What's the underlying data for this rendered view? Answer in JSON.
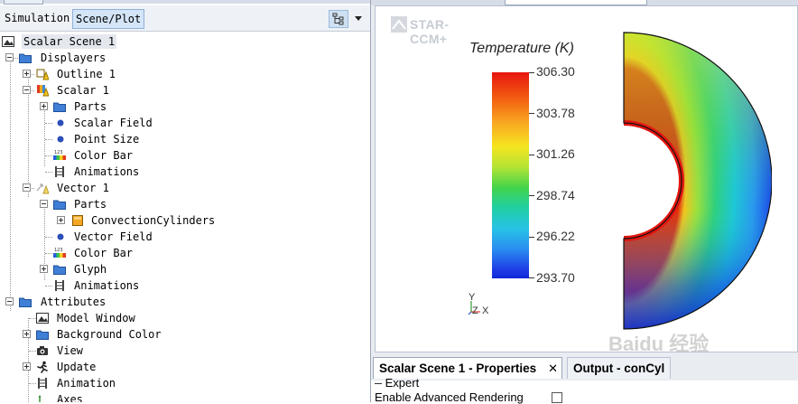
{
  "tabs": {
    "simulation": "Simulation",
    "scene_plot": "Scene/Plot"
  },
  "tree": [
    {
      "label": "Scalar Scene 1",
      "icon": "scene-icon",
      "selected": true
    },
    {
      "label": "Displayers",
      "icon": "folder-icon"
    },
    {
      "label": "Outline 1",
      "icon": "outline-displayer-icon"
    },
    {
      "label": "Scalar 1",
      "icon": "scalar-displayer-icon"
    },
    {
      "label": "Parts",
      "icon": "folder-icon"
    },
    {
      "label": "Scalar Field",
      "icon": "bullet-icon"
    },
    {
      "label": "Point Size",
      "icon": "bullet-icon"
    },
    {
      "label": "Color Bar",
      "icon": "color-bar-icon"
    },
    {
      "label": "Animations",
      "icon": "animations-icon"
    },
    {
      "label": "Vector 1",
      "icon": "vector-displayer-icon"
    },
    {
      "label": "Parts",
      "icon": "folder-icon"
    },
    {
      "label": "ConvectionCylinders",
      "icon": "region-icon"
    },
    {
      "label": "Vector Field",
      "icon": "bullet-icon"
    },
    {
      "label": "Color Bar",
      "icon": "color-bar-icon"
    },
    {
      "label": "Glyph",
      "icon": "folder-icon"
    },
    {
      "label": "Animations",
      "icon": "animations-icon"
    },
    {
      "label": "Attributes",
      "icon": "folder-icon"
    },
    {
      "label": "Model Window",
      "icon": "window-icon"
    },
    {
      "label": "Background Color",
      "icon": "folder-icon"
    },
    {
      "label": "View",
      "icon": "camera-icon"
    },
    {
      "label": "Update",
      "icon": "update-icon"
    },
    {
      "label": "Animation",
      "icon": "animations-icon"
    },
    {
      "label": "Axes",
      "icon": "axes-icon"
    }
  ],
  "viewport": {
    "logo": "STAR-CCM+",
    "triad": {
      "y": "Y",
      "z": "Z",
      "x": "X"
    },
    "watermark": "Baidu 经验"
  },
  "colorbar": {
    "title": "Temperature (K)",
    "labels": [
      "306.30",
      "303.78",
      "301.26",
      "298.74",
      "296.22",
      "293.70"
    ],
    "min": 293.7,
    "max": 306.3,
    "colors": [
      "#e6150f",
      "#f25a10",
      "#f9a521",
      "#f5e520",
      "#b4e434",
      "#43d44b",
      "#1fcfa5",
      "#27c3e6",
      "#2a8cf0",
      "#1d3ae6",
      "#1028d6"
    ]
  },
  "bottom_tabs": {
    "properties": "Scalar Scene 1 - Properties",
    "close_symbol": "✕",
    "output": "Output - conCyl"
  },
  "properties": {
    "expert_label": "Expert",
    "advanced_rendering_label": "Enable Advanced Rendering"
  }
}
